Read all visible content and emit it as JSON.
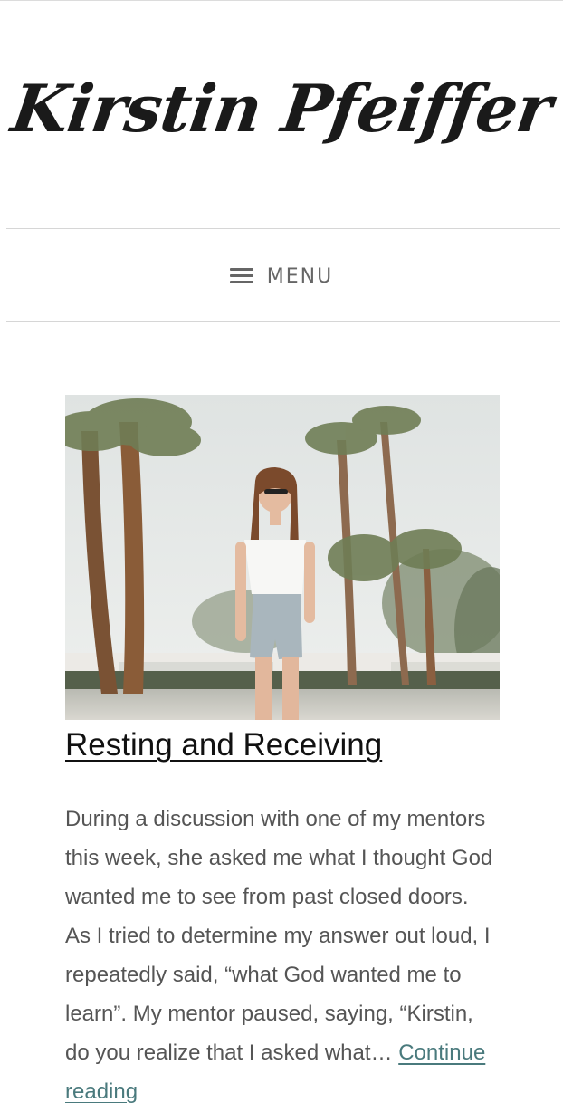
{
  "site": {
    "title": "Kirstin Pfeiffer"
  },
  "nav": {
    "menu_label": "MENU"
  },
  "post": {
    "title": "Resting and Receiving",
    "excerpt_lines": [
      "During a discussion with one of my mentors",
      "this week, she asked me what I thought God",
      "wanted me to see from past closed doors.",
      "As I tried to determine my answer out loud, I",
      "repeatedly said, “what God wanted me to",
      "learn”. My mentor paused, saying, “Kirstin,",
      "do you realize that I asked what…"
    ],
    "continue_label_1": "Continue",
    "continue_label_2": "reading"
  },
  "colors": {
    "link": "#4a7a7d",
    "text": "#555555",
    "title": "#111111"
  }
}
